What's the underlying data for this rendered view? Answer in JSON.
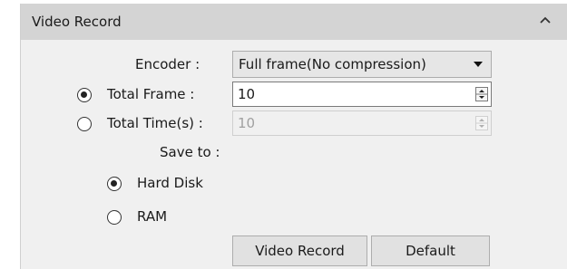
{
  "panel": {
    "title": "Video Record",
    "collapse_icon": "chevron-up-icon"
  },
  "encoder": {
    "label": "Encoder :",
    "value": "Full frame(No compression)",
    "arrow_icon": "triangle-down-icon"
  },
  "total_frame": {
    "label": "Total Frame  :",
    "value": "10",
    "checked": true
  },
  "total_time": {
    "label": "Total Time(s) :",
    "value": "10",
    "checked": false,
    "disabled": true
  },
  "save_to": {
    "label": "Save to :",
    "options": [
      {
        "label": "Hard Disk",
        "checked": true
      },
      {
        "label": "RAM",
        "checked": false
      }
    ]
  },
  "buttons": {
    "record": "Video Record",
    "default": "Default"
  }
}
